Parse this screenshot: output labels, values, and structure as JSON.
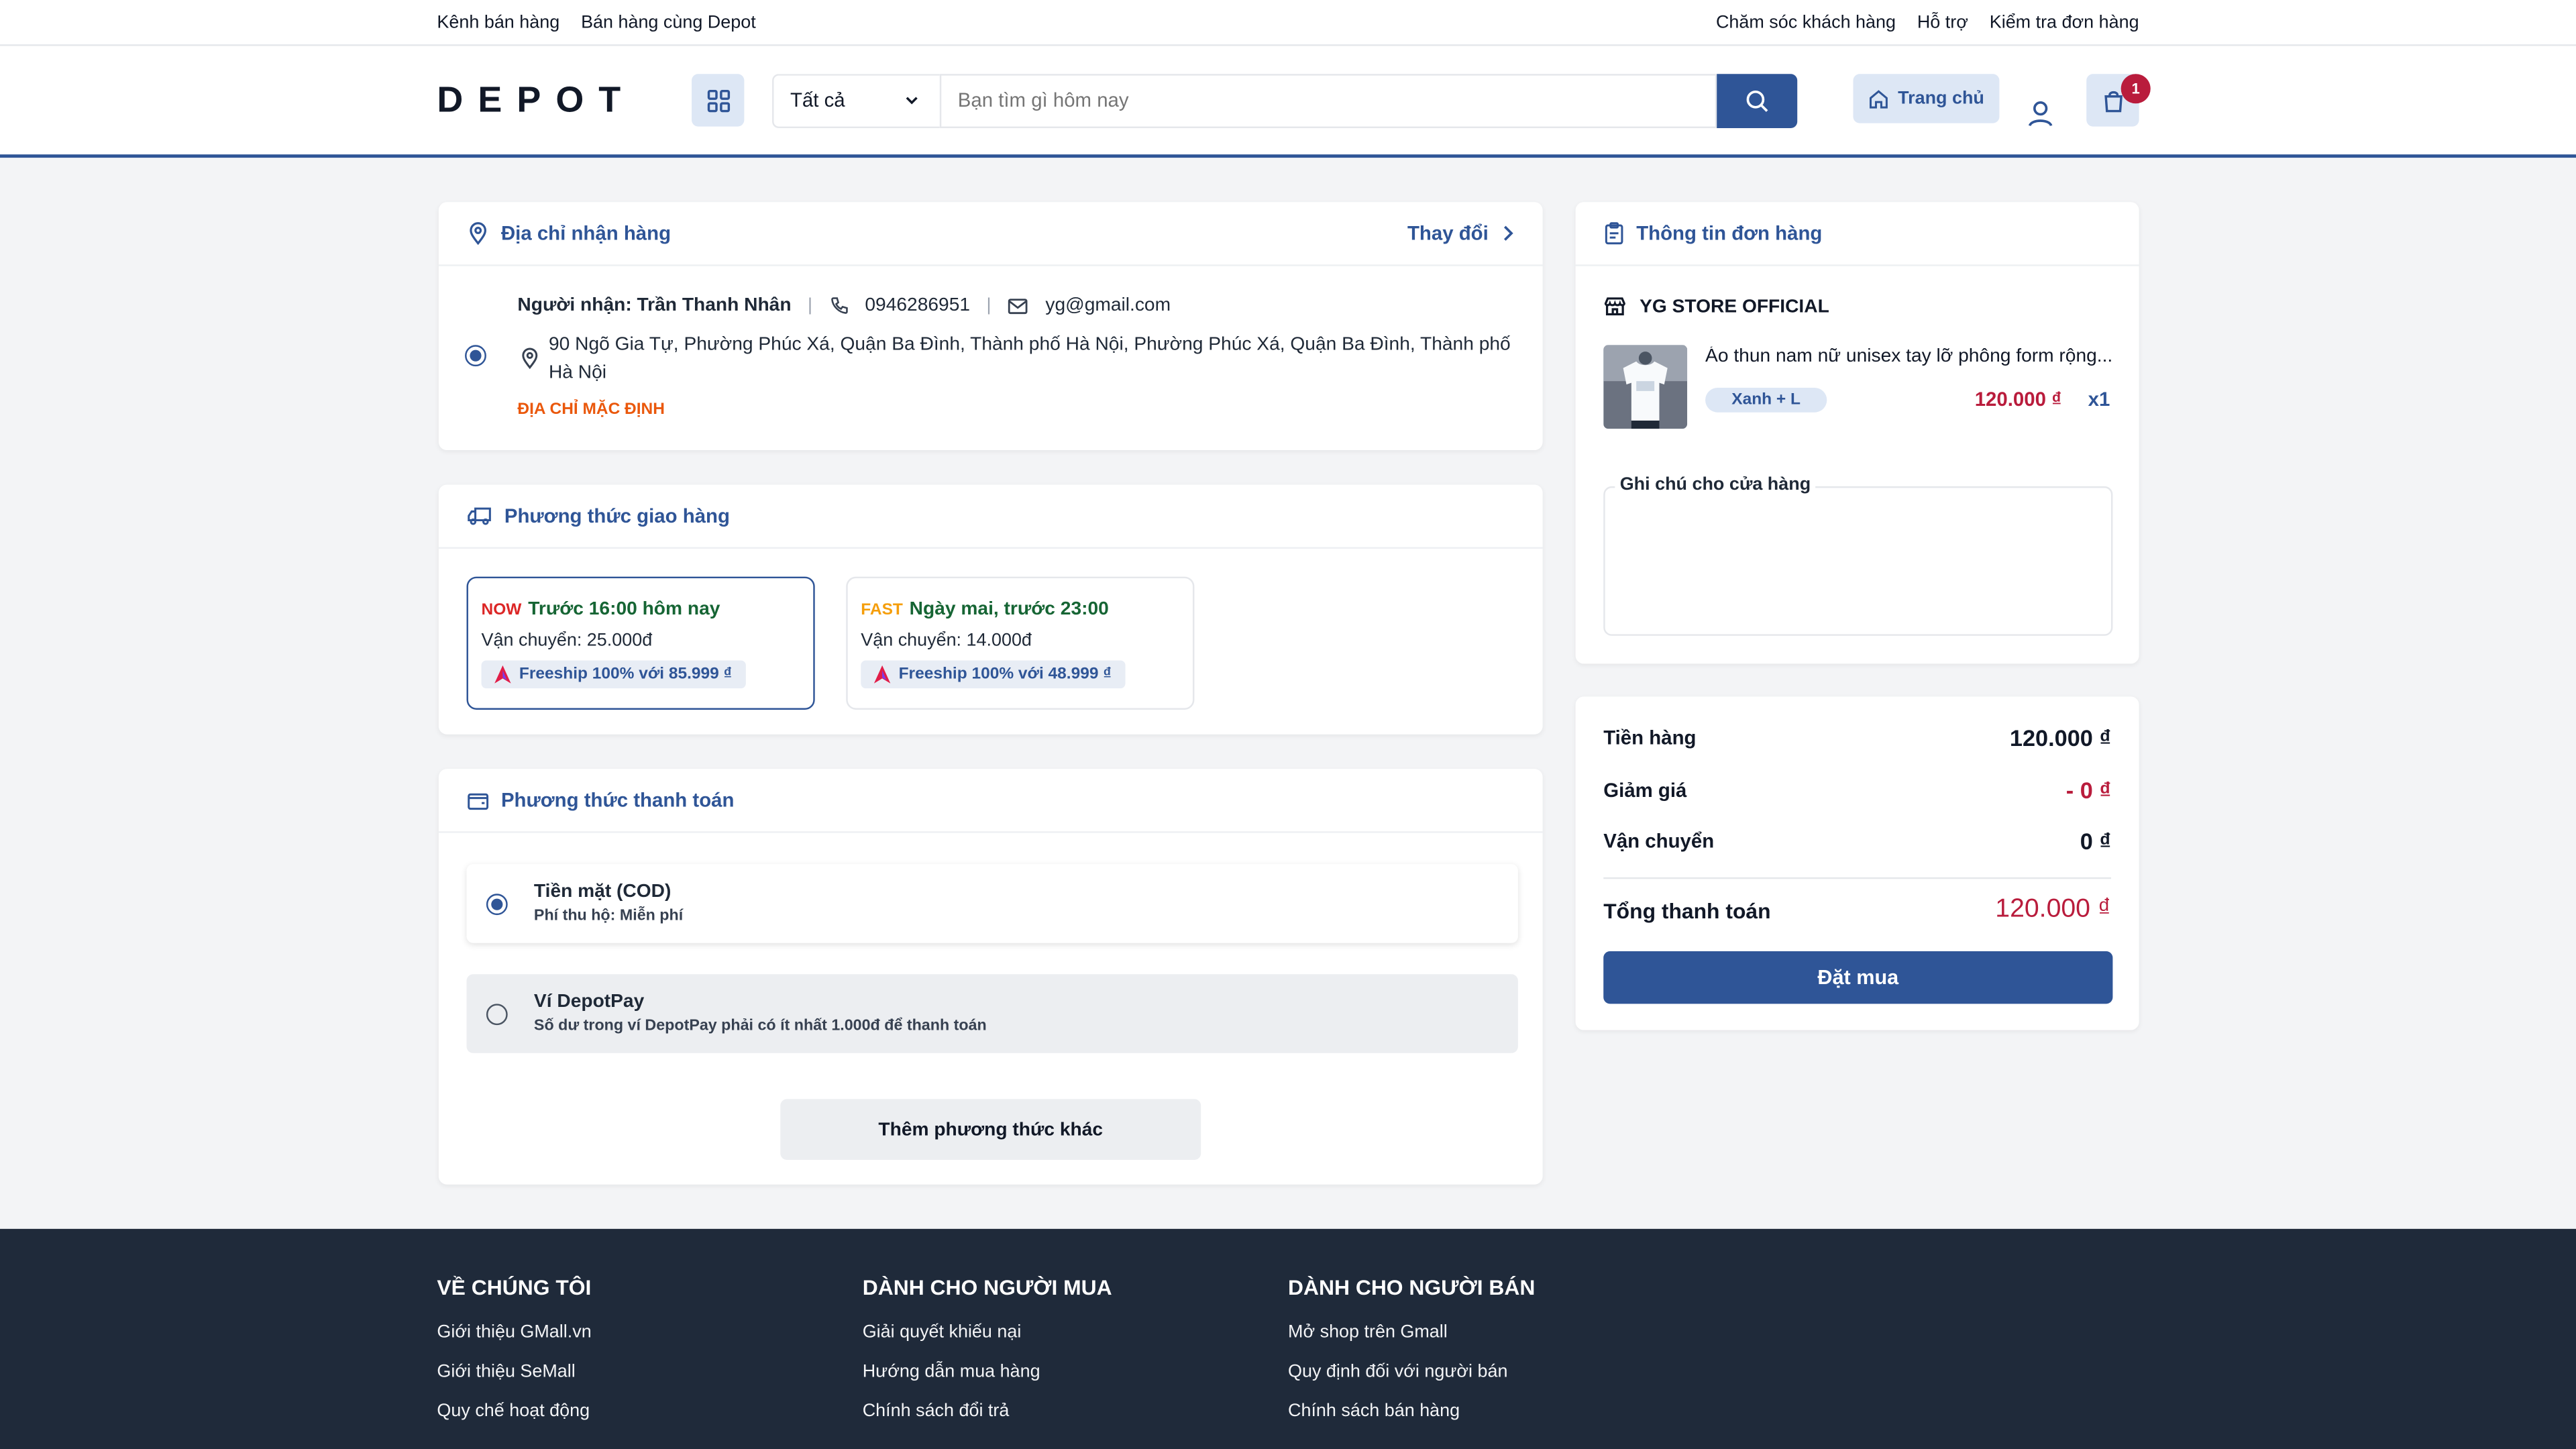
{
  "topbar": {
    "left": [
      "Kênh bán hàng",
      "Bán hàng cùng Depot"
    ],
    "right": [
      "Chăm sóc khách hàng",
      "Hỗ trợ",
      "Kiểm tra đơn hàng"
    ]
  },
  "header": {
    "logo": "DEPOT",
    "category_select": "Tất cả",
    "search_placeholder": "Bạn tìm gì hôm nay",
    "home_label": "Trang chủ",
    "cart_count": "1"
  },
  "address": {
    "title": "Địa chỉ nhận hàng",
    "change": "Thay đổi",
    "recipient": "Người nhận: Trần Thanh Nhân",
    "phone": "0946286951",
    "email": "yg@gmail.com",
    "line1": "90 Ngõ Gia Tự, Phường Phúc Xá, Quận Ba Đình, Thành phố Hà Nội, Phường Phúc Xá, Quận Ba Đình, Thành phố",
    "line2": "Hà Nội",
    "default_tag": "ĐỊA CHỈ MẶC ĐỊNH"
  },
  "shipping": {
    "title": "Phương thức giao hàng",
    "options": [
      {
        "tag": "NOW",
        "tag_color": "#dc2626",
        "title": "Trước 16:00 hôm nay",
        "fee": "Vận chuyển: 25.000đ",
        "freeship": "Freeship 100% với 85.999 ₫",
        "selected": true
      },
      {
        "tag": "FAST",
        "tag_color": "#f59e0b",
        "title": "Ngày mai, trước 23:00",
        "fee": "Vận chuyển: 14.000đ",
        "freeship": "Freeship 100% với 48.999 ₫",
        "selected": false
      }
    ]
  },
  "payment": {
    "title": "Phương thức thanh toán",
    "options": [
      {
        "title": "Tiền mặt (COD)",
        "sub": "Phí thu hộ: Miễn phí",
        "selected": true
      },
      {
        "title": "Ví DepotPay",
        "sub": "Số dư trong ví DepotPay phải có ít nhất 1.000đ để thanh toán",
        "selected": false
      }
    ],
    "more": "Thêm phương thức khác"
  },
  "order": {
    "title": "Thông tin đơn hàng",
    "store": "YG STORE OFFICIAL",
    "product_name": "Áo thun nam nữ unisex tay lỡ phông form rộng...",
    "variant": "Xanh + L",
    "price": "120.000 ₫",
    "qty": "x1",
    "note_label": "Ghi chú cho cửa hàng"
  },
  "summary": {
    "rows": [
      {
        "label": "Tiền hàng",
        "value": "120.000 ₫"
      },
      {
        "label": "Giảm giá",
        "value": "- 0 ₫"
      },
      {
        "label": "Vận chuyển",
        "value": "0 ₫"
      }
    ],
    "total_label": "Tổng thanh toán",
    "total_value": "120.000 ₫",
    "order_button": "Đặt mua"
  },
  "footer": {
    "cols": [
      {
        "title": "VỀ CHÚNG TÔI",
        "items": [
          "Giới thiệu GMall.vn",
          "Giới thiệu SeMall",
          "Quy chế hoạt động"
        ]
      },
      {
        "title": "DÀNH CHO NGƯỜI MUA",
        "items": [
          "Giải quyết khiếu nại",
          "Hướng dẫn mua hàng",
          "Chính sách đổi trả"
        ]
      },
      {
        "title": "DÀNH CHO NGƯỜI BÁN",
        "items": [
          "Mở shop trên Gmall",
          "Quy định đối với người bán",
          "Chính sách bán hàng"
        ]
      }
    ]
  },
  "colors": {
    "primary": "#2f5597",
    "accent_red": "#b91c3c",
    "default_tag": "#ea580c"
  }
}
